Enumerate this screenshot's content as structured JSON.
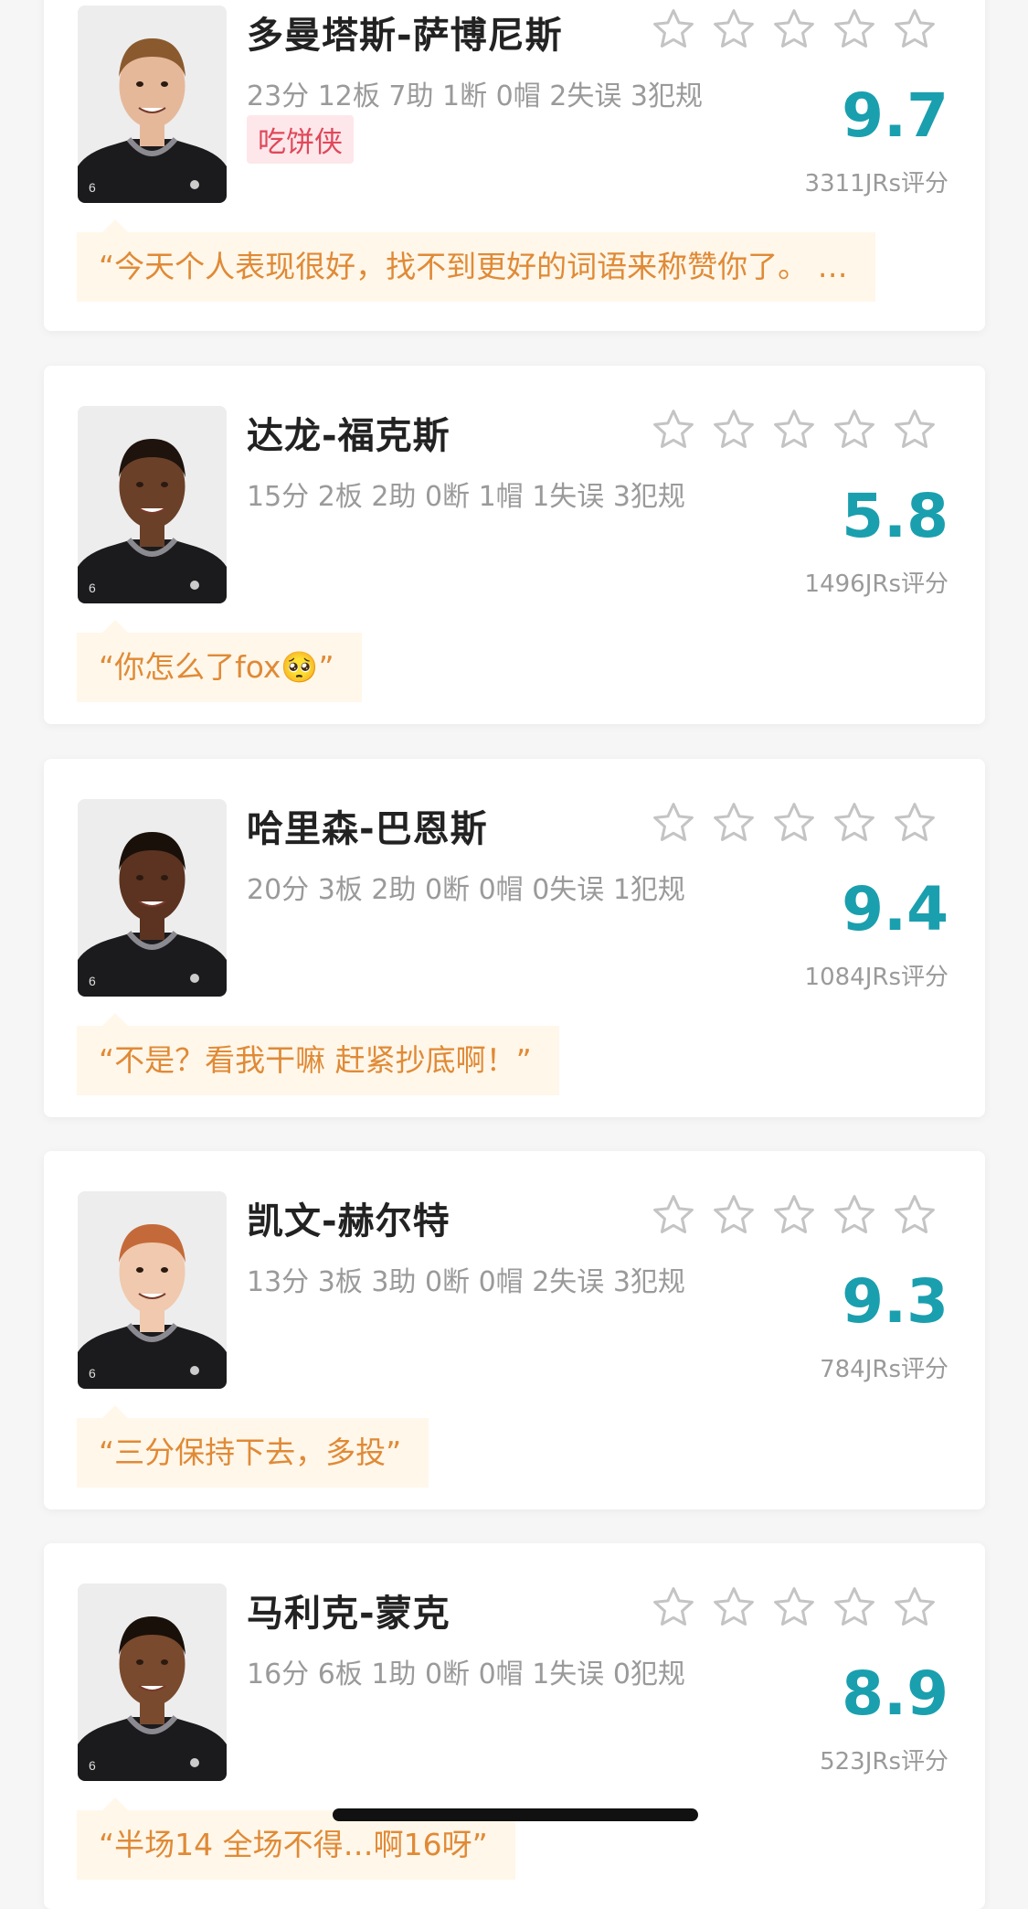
{
  "players": [
    {
      "name": "多曼塔斯-萨博尼斯",
      "stats": "23分 12板 7助 1断 0帽 2失误 3犯规",
      "badge": "吃饼侠",
      "score": "9.7",
      "ratings": "3311JRs评分",
      "comment": "“今天个人表现很好，找不到更好的词语来称赞你了。 …",
      "skin": "#e6b89a",
      "hair": "#8a5a2e"
    },
    {
      "name": "达龙-福克斯",
      "stats": "15分 2板 2助 0断 1帽 1失误 3犯规",
      "badge": "",
      "score": "5.8",
      "ratings": "1496JRs评分",
      "comment": "“你怎么了fox🥺”",
      "skin": "#6b4028",
      "hair": "#1e130d"
    },
    {
      "name": "哈里森-巴恩斯",
      "stats": "20分 3板 2助 0断 0帽 0失误 1犯规",
      "badge": "",
      "score": "9.4",
      "ratings": "1084JRs评分",
      "comment": "“不是？看我干嘛 赶紧抄底啊！”",
      "skin": "#5b3320",
      "hair": "#1a100a"
    },
    {
      "name": "凯文-赫尔特",
      "stats": "13分 3板 3助 0断 0帽 2失误 3犯规",
      "badge": "",
      "score": "9.3",
      "ratings": "784JRs评分",
      "comment": "“三分保持下去，多投”",
      "skin": "#f0c9ae",
      "hair": "#c46a3a"
    },
    {
      "name": "马利克-蒙克",
      "stats": "16分 6板 1助 0断 0帽 1失误 0犯规",
      "badge": "",
      "score": "8.9",
      "ratings": "523JRs评分",
      "comment": "“半场14 全场不得…啊16呀”",
      "skin": "#7a4a2e",
      "hair": "#1a100a"
    }
  ],
  "star_count": 5,
  "colors": {
    "score": "#1a9fae",
    "comment_bg": "#fff7ea",
    "comment_text": "#e08a36",
    "badge_bg": "#fde7ea",
    "badge_text": "#e0485a"
  },
  "icons": {
    "star": "star-outline-icon",
    "jersey": "kings-black-jersey"
  }
}
